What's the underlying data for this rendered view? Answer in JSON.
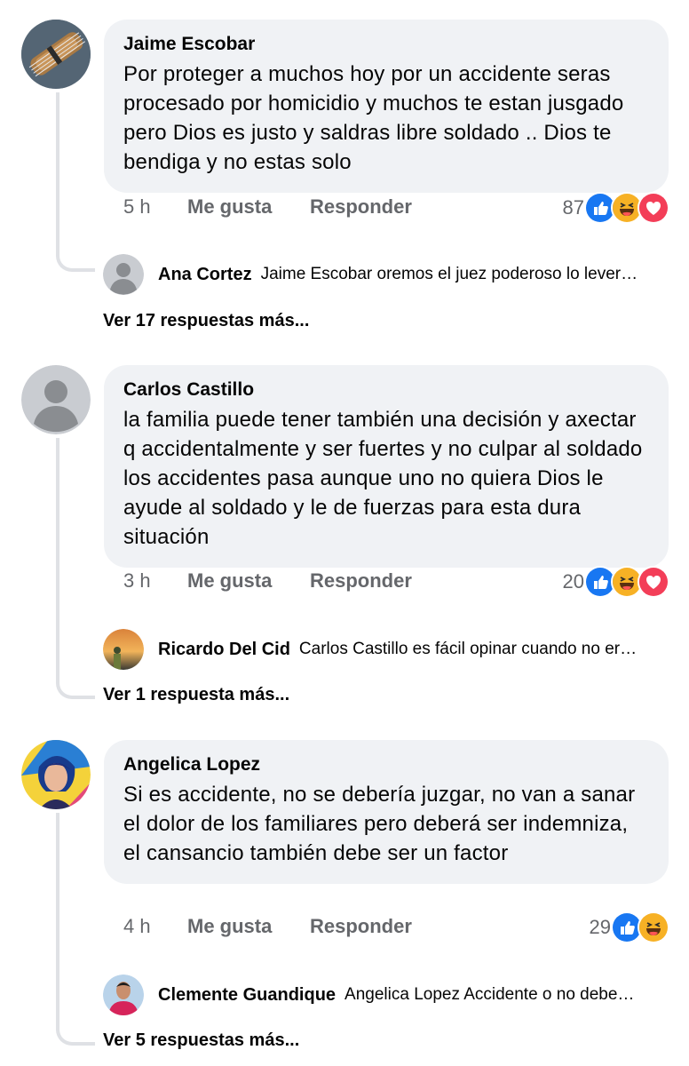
{
  "comments": [
    {
      "author": "Jaime Escobar",
      "text": "Por proteger a muchos hoy por un accidente seras procesado por homicidio y muchos te estan jusgado pero Dios es justo y saldras libre soldado .. Dios te bendiga y no estas solo",
      "time": "5 h",
      "like_label": "Me gusta",
      "reply_label": "Responder",
      "reaction_count": "87",
      "reactions": [
        "like-icon",
        "haha-icon",
        "love-icon"
      ],
      "avatar": "bass-guitar-photo",
      "reply": {
        "author": "Ana Cortez",
        "text": "Jaime Escobar oremos el juez poderoso lo lever…",
        "avatar": "default-avatar"
      },
      "more_replies": "Ver 17 respuestas más..."
    },
    {
      "author": "Carlos Castillo",
      "text": "la familia puede tener también una decisión y axectar q accidentalmente y ser fuertes y no culpar al soldado los accidentes pasa aunque uno no quiera Dios le ayude al soldado y le de fuerzas para esta dura situación",
      "time": "3 h",
      "like_label": "Me gusta",
      "reply_label": "Responder",
      "reaction_count": "20",
      "reactions": [
        "like-icon",
        "haha-icon",
        "love-icon"
      ],
      "avatar": "default-avatar",
      "reply": {
        "author": "Ricardo Del Cid",
        "text": "Carlos Castillo es fácil opinar cuando no er…",
        "avatar": "sunset-photo"
      },
      "more_replies": "Ver 1 respuesta más..."
    },
    {
      "author": "Angelica Lopez",
      "text": "Si es accidente, no se debería juzgar, no van a sanar el dolor de los familiares pero deberá ser indemniza, el cansancio también debe ser un factor",
      "time": "4 h",
      "like_label": "Me gusta",
      "reply_label": "Responder",
      "reaction_count": "29",
      "reactions": [
        "like-icon",
        "haha-icon"
      ],
      "avatar": "portrait-illustration",
      "reply": {
        "author": "Clemente Guandique",
        "text": "Angelica Lopez Accidente o no debe…",
        "avatar": "man-portrait-photo"
      },
      "more_replies": "Ver 5 respuestas más..."
    }
  ],
  "colors": {
    "bubble": "#f0f2f5",
    "meta_text": "#65676b",
    "like_blue": "#1877f2",
    "haha_yellow": "#f7b125",
    "love_red": "#f33e58",
    "thread_line": "#dfe1e5"
  }
}
